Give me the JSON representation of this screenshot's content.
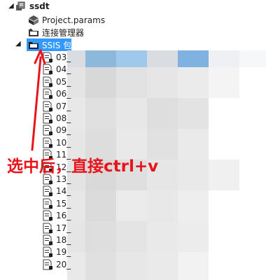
{
  "tree": {
    "root": {
      "label": "ssdt",
      "icon": "solution-icon"
    },
    "items": [
      {
        "label": "Project.params",
        "icon": "params-icon"
      },
      {
        "label": "连接管理器",
        "icon": "folder-icon"
      },
      {
        "label": "SSIS 包",
        "icon": "folder-icon",
        "selected": true,
        "expanded": true
      }
    ],
    "packages": [
      "03_",
      "04_",
      "05_",
      "06_",
      "07_",
      "08_",
      "09_",
      "10_",
      "11_",
      "12_",
      "13_",
      "14_",
      "15_",
      "16_",
      "17_",
      "18_",
      "19_",
      "20_"
    ]
  },
  "annotation": {
    "text": "选中后，直接ctrl+v",
    "color": "#e8141b"
  },
  "colors": {
    "selection": "#3399ff",
    "annotation": "#e8141b",
    "blur_blue_1": "#8cb8db",
    "blur_blue_2": "#9ec9ed"
  }
}
